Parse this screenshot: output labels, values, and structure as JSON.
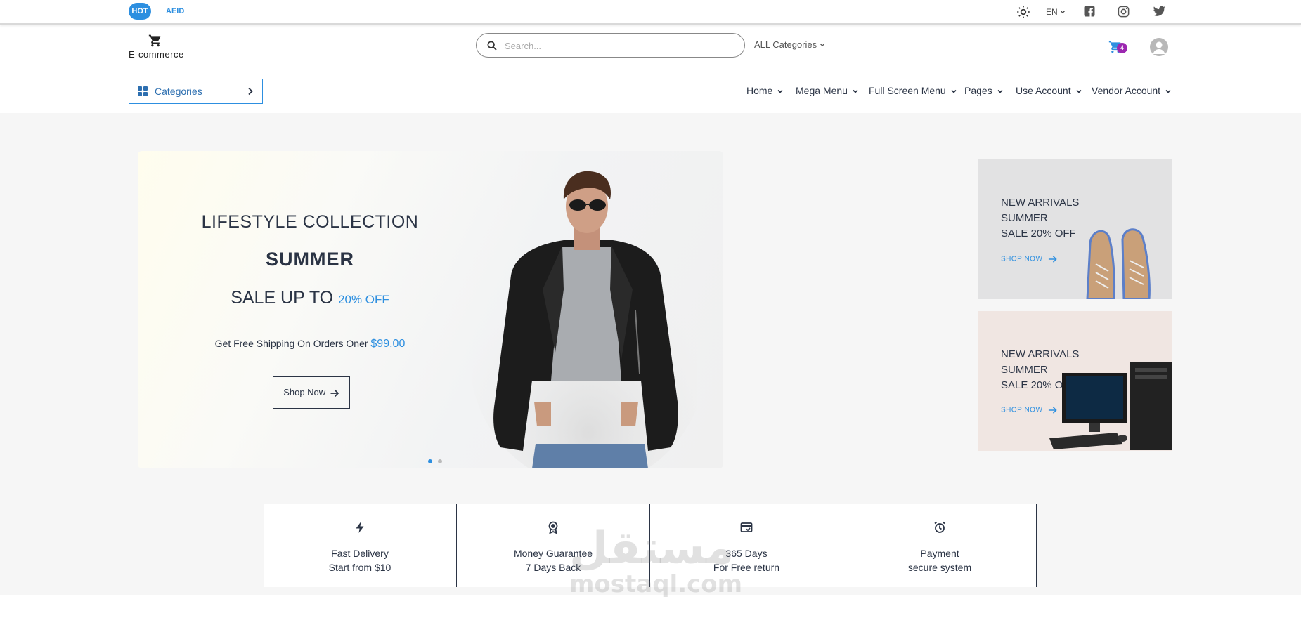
{
  "topbar": {
    "hot_label": "HOT",
    "aeid_label": "AEID",
    "lang": "EN",
    "icons": [
      "sun-icon",
      "facebook-icon",
      "instagram-icon",
      "twitter-icon"
    ]
  },
  "header": {
    "logo_text": "E-commerce",
    "search_placeholder": "Search...",
    "all_categories": "ALL Categories",
    "cart_count": "4"
  },
  "nav": {
    "categories_label": "Categories",
    "items": [
      "Home",
      "Mega Menu",
      "Full Screen Menu",
      "Pages",
      "Use Account",
      "Vendor Account"
    ]
  },
  "hero": {
    "line1": "LIFESTYLE COLLECTION",
    "line2": "SUMMER",
    "line3": "SALE UP TO",
    "line3_accent": "20% OFF",
    "line4": "Get Free Shipping On Orders Oner",
    "line4_accent": "$99.00",
    "button": "Shop Now"
  },
  "promos": [
    {
      "l1": "NEW ARRIVALS",
      "l2": "SUMMER",
      "l3": "SALE 20% OFF",
      "cta": "SHOP NOW"
    },
    {
      "l1": "NEW ARRIVALS",
      "l2": "SUMMER",
      "l3": "SALE 20% OFF",
      "cta": "SHOP NOW"
    }
  ],
  "services": [
    {
      "title": "Fast Delivery",
      "sub": "Start from $10"
    },
    {
      "title": "Money Guarantee",
      "sub": "7 Days Back"
    },
    {
      "title": "365 Days",
      "sub": "For Free return"
    },
    {
      "title": "Payment",
      "sub": "secure system"
    }
  ],
  "watermark": {
    "ar": "مستقل",
    "en": "mostaql.com"
  },
  "colors": {
    "accent": "#2d8fe0",
    "text": "#2b3445",
    "badge": "#9c27b0"
  }
}
